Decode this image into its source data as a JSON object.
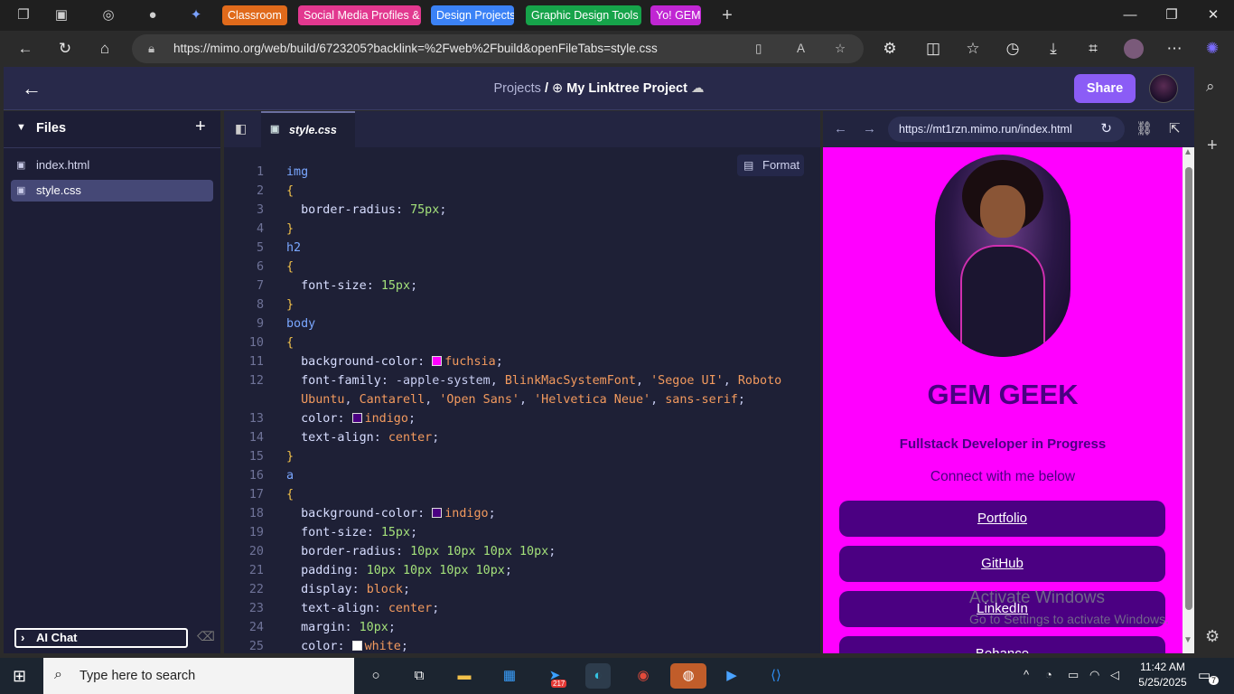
{
  "browser": {
    "favorites": [
      {
        "label": "Classroom",
        "color": "#e06a1b"
      },
      {
        "label": "Social Media Profiles &",
        "color": "#e2388f"
      },
      {
        "label": "Design Projects",
        "color": "#3b82f6"
      },
      {
        "label": "Graphic Design Tools",
        "color": "#16a34a"
      },
      {
        "label": "Yo! GEM",
        "color": "#c026d3"
      }
    ],
    "url": "https://mimo.org/web/build/6723205?backlink=%2Fweb%2Fbuild&openFileTabs=style.css"
  },
  "app": {
    "crumb_projects": "Projects",
    "crumb_sep": "/",
    "project_name": "My Linktree Project",
    "share_label": "Share"
  },
  "files": {
    "title": "Files",
    "items": [
      {
        "name": "index.html",
        "selected": false
      },
      {
        "name": "style.css",
        "selected": true
      }
    ],
    "ai_chat": "AI Chat"
  },
  "editor": {
    "tab_label": "style.css",
    "format_label": "Format",
    "lines": [
      {
        "n": "1",
        "t": "img"
      },
      {
        "n": "2",
        "t": "{"
      },
      {
        "n": "3",
        "t": "  border-radius: 75px;"
      },
      {
        "n": "4",
        "t": "}"
      },
      {
        "n": "5",
        "t": "h2"
      },
      {
        "n": "6",
        "t": "{"
      },
      {
        "n": "7",
        "t": "  font-size: 15px;"
      },
      {
        "n": "8",
        "t": "}"
      },
      {
        "n": "9",
        "t": "body"
      },
      {
        "n": "10",
        "t": "{"
      },
      {
        "n": "11",
        "t": "  background-color: fuchsia;"
      },
      {
        "n": "12",
        "t": "  font-family: -apple-system, BlinkMacSystemFont, 'Segoe UI', Roboto"
      },
      {
        "n": "",
        "t": "  Ubuntu, Cantarell, 'Open Sans', 'Helvetica Neue', sans-serif;"
      },
      {
        "n": "13",
        "t": "  color: indigo;"
      },
      {
        "n": "14",
        "t": "  text-align: center;"
      },
      {
        "n": "15",
        "t": "}"
      },
      {
        "n": "16",
        "t": "a"
      },
      {
        "n": "17",
        "t": "{"
      },
      {
        "n": "18",
        "t": "  background-color: indigo;"
      },
      {
        "n": "19",
        "t": "  font-size: 15px;"
      },
      {
        "n": "20",
        "t": "  border-radius: 10px 10px 10px 10px;"
      },
      {
        "n": "21",
        "t": "  padding: 10px 10px 10px 10px;"
      },
      {
        "n": "22",
        "t": "  display: block;"
      },
      {
        "n": "23",
        "t": "  text-align: center;"
      },
      {
        "n": "24",
        "t": "  margin: 10px;"
      },
      {
        "n": "25",
        "t": "  color: white;"
      }
    ]
  },
  "preview": {
    "url": "https://mt1rzn.mimo.run/index.html",
    "heading": "GEM GEEK",
    "subtitle": "Fullstack Developer in Progress",
    "connect": "Connect with me below",
    "links": [
      "Portfolio",
      "GitHub",
      "LinkedIn",
      "Behance"
    ],
    "bg_color": "#ff00ff",
    "link_color": "#4b0082"
  },
  "watermark": {
    "title": "Activate Windows",
    "subtitle": "Go to Settings to activate Windows."
  },
  "taskbar": {
    "search_placeholder": "Type here to search",
    "time": "11:42 AM",
    "date": "5/25/2025",
    "badge_count": "217",
    "notif_count": "7"
  }
}
